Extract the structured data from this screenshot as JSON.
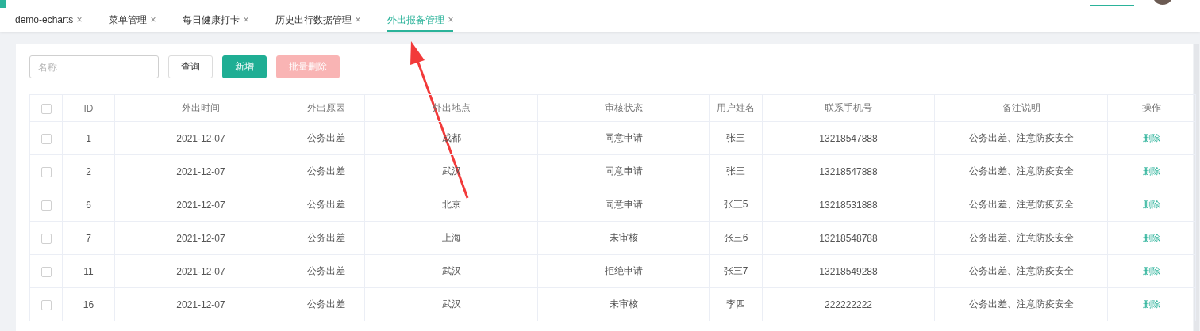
{
  "tabs": [
    {
      "label": "demo-echarts",
      "close": "×",
      "selected": false
    },
    {
      "label": "菜单管理",
      "close": "×",
      "selected": false
    },
    {
      "label": "每日健康打卡",
      "close": "×",
      "selected": false
    },
    {
      "label": "历史出行数据管理",
      "close": "×",
      "selected": false
    },
    {
      "label": "外出报备管理",
      "close": "×",
      "selected": true
    }
  ],
  "toolbar": {
    "search": {
      "placeholder": "名称"
    },
    "buttons": [
      {
        "label": "查询",
        "kind": "plain",
        "disabled": false
      },
      {
        "label": "新增",
        "kind": "primary",
        "disabled": false
      },
      {
        "label": "批量删除",
        "kind": "danger",
        "disabled": true
      }
    ]
  },
  "table": {
    "select_all": {
      "checked": false
    },
    "columns": [
      "ID",
      "外出时间",
      "外出原因",
      "外出地点",
      "审核状态",
      "用户姓名",
      "联系手机号",
      "备注说明",
      "操作"
    ],
    "rows": [
      {
        "checked": false,
        "cells": [
          "1",
          "2021-12-07",
          "公务出差",
          "成都",
          "同意申请",
          "张三",
          "13218547888",
          "公务出差、注意防疫安全"
        ],
        "action": "删除"
      },
      {
        "checked": false,
        "cells": [
          "2",
          "2021-12-07",
          "公务出差",
          "武汉",
          "同意申请",
          "张三",
          "13218547888",
          "公务出差、注意防疫安全"
        ],
        "action": "删除"
      },
      {
        "checked": false,
        "cells": [
          "6",
          "2021-12-07",
          "公务出差",
          "北京",
          "同意申请",
          "张三5",
          "13218531888",
          "公务出差、注意防疫安全"
        ],
        "action": "删除"
      },
      {
        "checked": false,
        "cells": [
          "7",
          "2021-12-07",
          "公务出差",
          "上海",
          "未审核",
          "张三6",
          "13218548788",
          "公务出差、注意防疫安全"
        ],
        "action": "删除"
      },
      {
        "checked": false,
        "cells": [
          "11",
          "2021-12-07",
          "公务出差",
          "武汉",
          "拒绝申请",
          "张三7",
          "13218549288",
          "公务出差、注意防疫安全"
        ],
        "action": "删除"
      },
      {
        "checked": false,
        "cells": [
          "16",
          "2021-12-07",
          "公务出差",
          "武汉",
          "未审核",
          "李四",
          "222222222",
          "公务出差、注意防疫安全"
        ],
        "action": "删除"
      }
    ]
  }
}
